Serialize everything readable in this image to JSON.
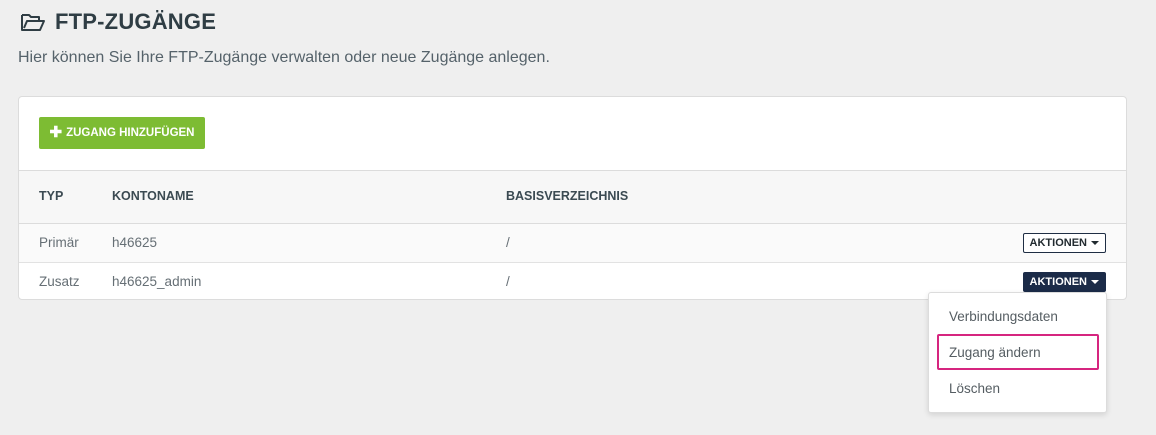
{
  "header": {
    "title": "FTP-ZUGÄNGE",
    "icon": "folder-open-icon",
    "subtitle": "Hier können Sie Ihre FTP-Zugänge verwalten oder neue Zugänge anlegen."
  },
  "toolbar": {
    "add_label": "ZUGANG HINZUFÜGEN",
    "add_icon": "plus-icon",
    "add_color": "#7dbc33"
  },
  "table": {
    "columns": {
      "typ": "TYP",
      "kontoname": "KONTONAME",
      "basisverzeichnis": "BASISVERZEICHNIS"
    },
    "rows": [
      {
        "typ": "Primär",
        "kontoname": "h46625",
        "basis": "/",
        "actions_label": "AKTIONEN"
      },
      {
        "typ": "Zusatz",
        "kontoname": "h46625_admin",
        "basis": "/",
        "actions_label": "AKTIONEN"
      }
    ]
  },
  "dropdown": {
    "items": [
      {
        "label": "Verbindungsdaten"
      },
      {
        "label": "Zugang ändern",
        "highlighted": true
      },
      {
        "label": "Löschen"
      }
    ],
    "highlight_color": "#d6257f"
  },
  "colors": {
    "actions_active": "#1b2b48",
    "background": "#efefef"
  }
}
